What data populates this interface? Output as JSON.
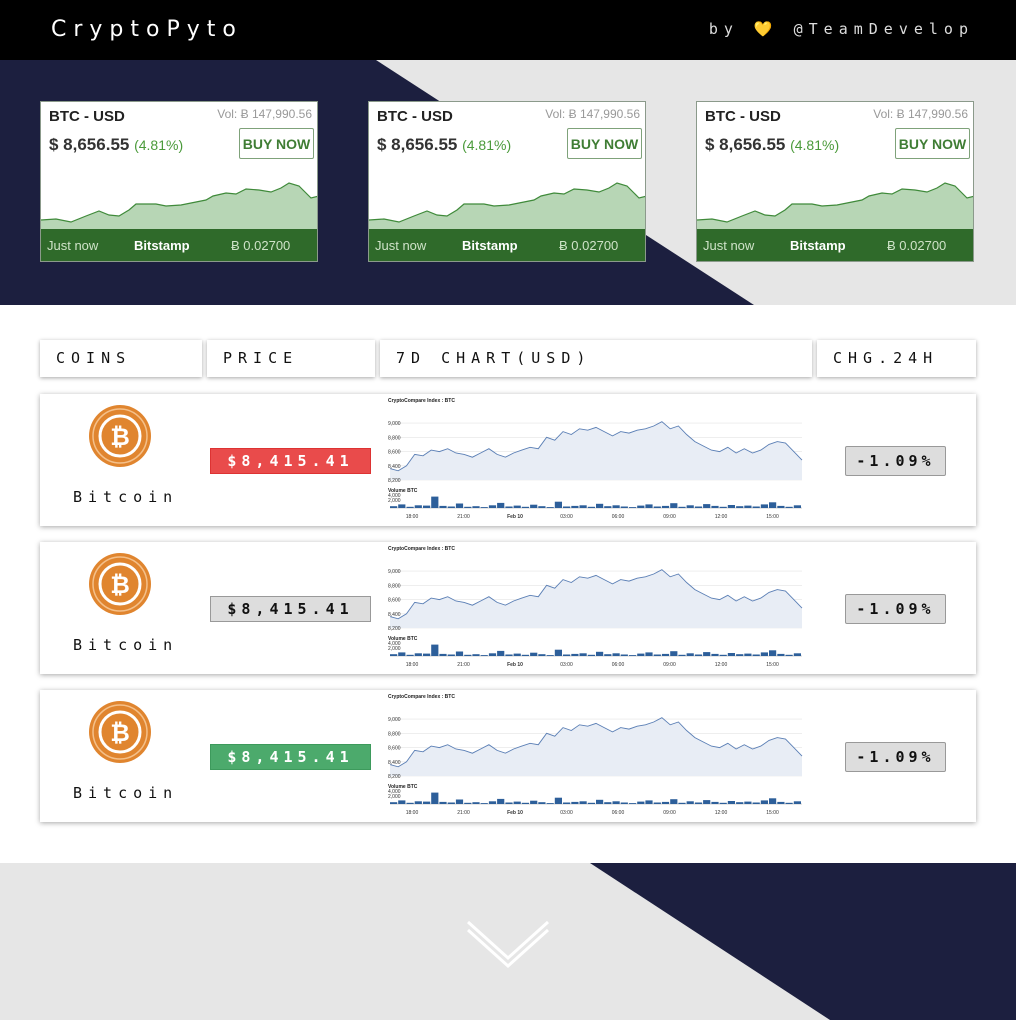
{
  "header": {
    "brand": "CryptoPyto",
    "by": "by",
    "heart_icon": "💛",
    "handle": "@TeamDevelop"
  },
  "tickers": [
    {
      "pair": "BTC - USD",
      "vol": "Vol: Ƀ 147,990.56",
      "price": "$ 8,656.55",
      "change": "(4.81%)",
      "buy": "BUY NOW",
      "time": "Just now",
      "exchange": "Bitstamp",
      "amount": "Ƀ 0.02700"
    },
    {
      "pair": "BTC - USD",
      "vol": "Vol: Ƀ 147,990.56",
      "price": "$ 8,656.55",
      "change": "(4.81%)",
      "buy": "BUY NOW",
      "time": "Just now",
      "exchange": "Bitstamp",
      "amount": "Ƀ 0.02700"
    },
    {
      "pair": "BTC - USD",
      "vol": "Vol: Ƀ 147,990.56",
      "price": "$ 8,656.55",
      "change": "(4.81%)",
      "buy": "BUY NOW",
      "time": "Just now",
      "exchange": "Bitstamp",
      "amount": "Ƀ 0.02700"
    }
  ],
  "table": {
    "columns": [
      "COINS",
      "PRICE",
      "7D CHART(USD)",
      "CHG.24H"
    ],
    "rows": [
      {
        "coin": "Bitcoin",
        "price": "$8,415.41",
        "price_state": "down",
        "change": "-1.09%"
      },
      {
        "coin": "Bitcoin",
        "price": "$8,415.41",
        "price_state": "neutral",
        "change": "-1.09%"
      },
      {
        "coin": "Bitcoin",
        "price": "$8,415.41",
        "price_state": "up",
        "change": "-1.09%"
      }
    ]
  },
  "mini_chart": {
    "title": "CryptoCompare Index : BTC",
    "y_ticks": [
      "9,000",
      "8,800",
      "8,600",
      "8,400",
      "8,200"
    ],
    "volume_title": "Volume BTC",
    "volume_ticks": [
      "4,000",
      "2,000"
    ],
    "x_ticks": [
      "18:00",
      "21:00",
      "Feb 10",
      "03:00",
      "06:00",
      "09:00",
      "12:00",
      "15:00"
    ]
  },
  "colors": {
    "navy": "#1c1f3f",
    "light_gray": "#e6e6e6",
    "ticker_green": "#2f6a2a",
    "down_red": "#e94b4b",
    "up_green": "#4caa6c",
    "bitcoin_orange": "#e0852f"
  },
  "icons": {
    "bitcoin": "bitcoin-icon",
    "scroll_down": "chevron-down-icon"
  }
}
